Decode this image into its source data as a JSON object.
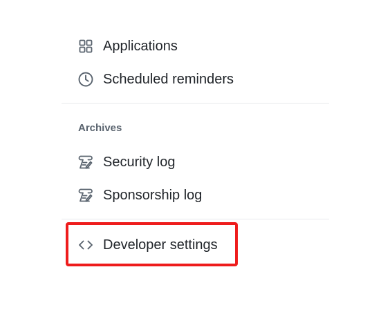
{
  "sidebar": {
    "items": [
      {
        "label": "Applications",
        "icon": "apps-icon"
      },
      {
        "label": "Scheduled reminders",
        "icon": "clock-icon"
      }
    ],
    "archives": {
      "heading": "Archives",
      "items": [
        {
          "label": "Security log",
          "icon": "log-icon"
        },
        {
          "label": "Sponsorship log",
          "icon": "log-icon"
        }
      ]
    },
    "developer": {
      "label": "Developer settings",
      "icon": "code-icon"
    }
  },
  "colors": {
    "text": "#1f2328",
    "icon": "#59636e",
    "heading": "#59636e",
    "divider": "#e7e9ec",
    "highlight": "#ee1c1c"
  }
}
